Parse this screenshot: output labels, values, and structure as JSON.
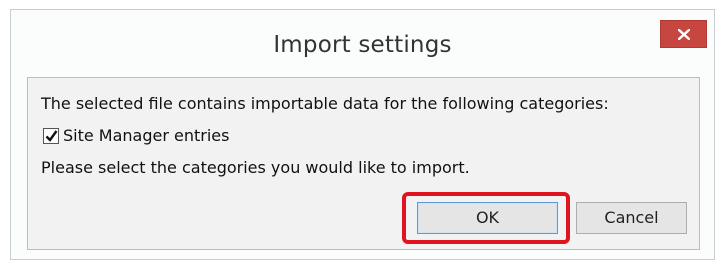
{
  "dialog": {
    "title": "Import settings",
    "close_icon": "close-icon",
    "description": "The selected file contains importable data for the following categories:",
    "categories": [
      {
        "label": "Site Manager entries",
        "checked": true
      }
    ],
    "prompt": "Please select the categories you would like to import.",
    "buttons": {
      "ok_label": "OK",
      "cancel_label": "Cancel"
    }
  },
  "colors": {
    "close_button": "#c7463f",
    "highlight_box": "#e0141e",
    "ok_focus_border": "#5b9bd5"
  }
}
